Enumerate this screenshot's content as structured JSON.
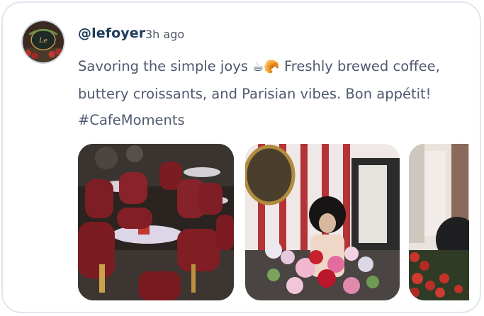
{
  "post": {
    "author_handle": "@lefoyer",
    "timestamp": "3h ago",
    "avatar_icon": "cafe-sign-avatar",
    "text_intro": "Savoring the simple joys",
    "text_emojis": "☕🥐",
    "text_rest": " Freshly brewed coffee, buttery croissants, and Parisian vibes. Bon appétit!",
    "hashtag": "#CafeMoments"
  },
  "gallery": {
    "photos": [
      {
        "icon": "cafe-terrace-photo"
      },
      {
        "icon": "woman-with-flowers-photo"
      },
      {
        "icon": "bibliotheque-sign-photo"
      }
    ]
  },
  "colors": {
    "border": "#dfe5ee",
    "handle": "#1f3b5a",
    "text": "#4f5870"
  }
}
